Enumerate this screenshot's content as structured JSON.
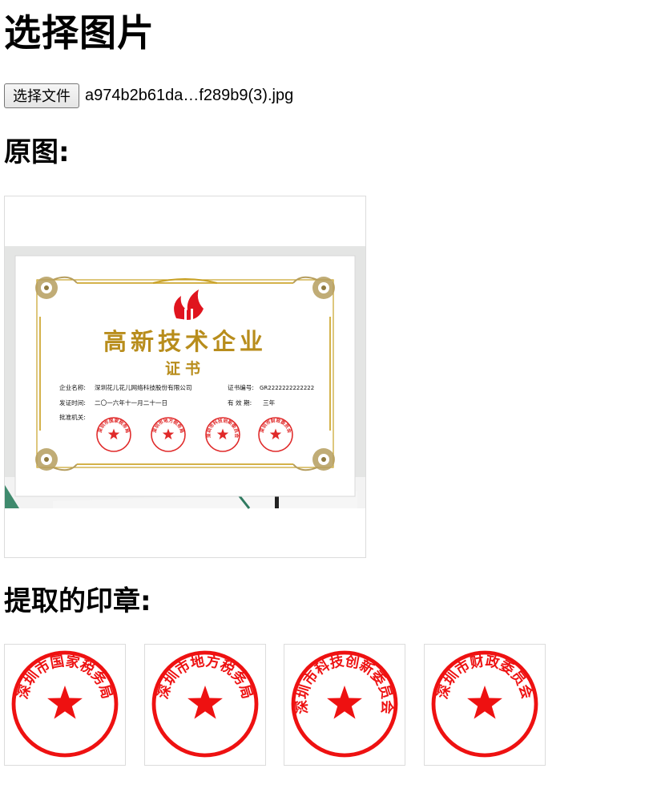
{
  "page": {
    "title": "选择图片",
    "original_heading": "原图:",
    "seals_heading": "提取的印章:"
  },
  "file_input": {
    "button_label": "选择文件",
    "file_name": "a974b2b61da…f289b9(3).jpg"
  },
  "certificate": {
    "title": "高新技术企业",
    "subtitle": "证书",
    "fields": {
      "company_label": "企业名称:",
      "company_value": "深圳花儿花儿网络科技股份有限公司",
      "number_label": "证书编号:",
      "number_value": "GR2222222222222",
      "date_label": "发证时间:",
      "date_value": "二〇一六年十一月二十一日",
      "validity_label": "有 效 期:",
      "validity_value": "三年",
      "authority_label": "批准机关:"
    }
  },
  "seals": [
    {
      "text": "深圳市国家税务局"
    },
    {
      "text": "深圳市地方税务局"
    },
    {
      "text": "深圳市科技创新委员会"
    },
    {
      "text": "深圳市财政委员会"
    }
  ],
  "colors": {
    "seal_red": "#ee1111",
    "gold": "#c9a227",
    "logo_red": "#e0141e"
  }
}
